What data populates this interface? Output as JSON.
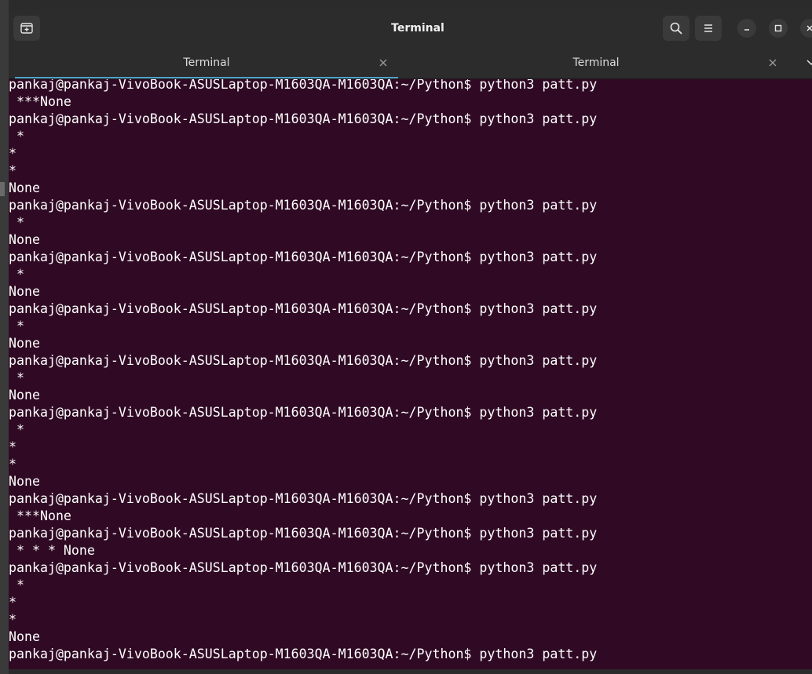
{
  "window": {
    "title": "Terminal"
  },
  "tabs": [
    {
      "label": "Terminal",
      "active": true
    },
    {
      "label": "Terminal",
      "active": false
    }
  ],
  "icons": {
    "new_tab": "new-tab-icon",
    "search": "search-icon",
    "menu": "hamburger-menu-icon",
    "minimize": "minimize-icon",
    "maximize": "maximize-icon",
    "close": "close-icon",
    "tab_close": "close-icon",
    "tab_overflow": "chevron-down-icon"
  },
  "colors": {
    "terminal_bg": "#300a24",
    "titlebar_bg": "#2c2c2c",
    "active_tab_accent": "#4fa3c7",
    "text": "#ffffff"
  },
  "terminal": {
    "lines": [
      "pankaj@pankaj-VivoBook-ASUSLaptop-M1603QA-M1603QA:~/Python$ python3 patt.py",
      " ***None",
      "pankaj@pankaj-VivoBook-ASUSLaptop-M1603QA-M1603QA:~/Python$ python3 patt.py",
      " *",
      "*",
      "*",
      "None",
      "pankaj@pankaj-VivoBook-ASUSLaptop-M1603QA-M1603QA:~/Python$ python3 patt.py",
      " *",
      "None",
      "pankaj@pankaj-VivoBook-ASUSLaptop-M1603QA-M1603QA:~/Python$ python3 patt.py",
      " *",
      "None",
      "pankaj@pankaj-VivoBook-ASUSLaptop-M1603QA-M1603QA:~/Python$ python3 patt.py",
      " *",
      "None",
      "pankaj@pankaj-VivoBook-ASUSLaptop-M1603QA-M1603QA:~/Python$ python3 patt.py",
      " *",
      "None",
      "pankaj@pankaj-VivoBook-ASUSLaptop-M1603QA-M1603QA:~/Python$ python3 patt.py",
      " *",
      "*",
      "*",
      "None",
      "pankaj@pankaj-VivoBook-ASUSLaptop-M1603QA-M1603QA:~/Python$ python3 patt.py",
      " ***None",
      "pankaj@pankaj-VivoBook-ASUSLaptop-M1603QA-M1603QA:~/Python$ python3 patt.py",
      " * * * None",
      "pankaj@pankaj-VivoBook-ASUSLaptop-M1603QA-M1603QA:~/Python$ python3 patt.py",
      " *",
      "*",
      "*",
      "None",
      "pankaj@pankaj-VivoBook-ASUSLaptop-M1603QA-M1603QA:~/Python$ python3 patt.py"
    ]
  }
}
